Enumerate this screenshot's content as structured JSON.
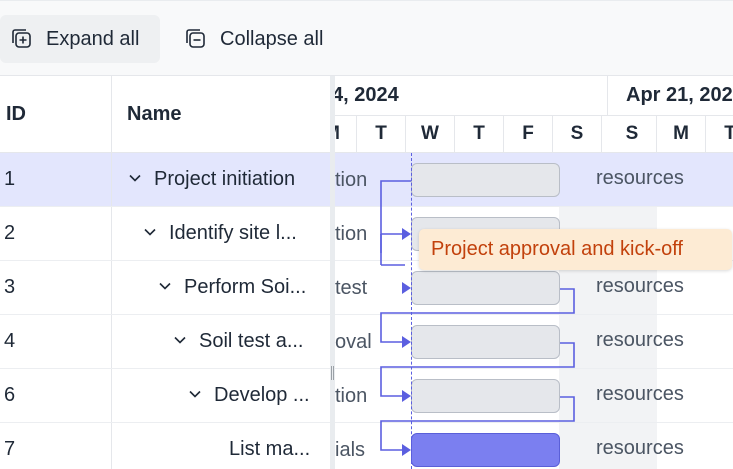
{
  "toolbar": {
    "expand_label": "Expand all",
    "collapse_label": "Collapse all",
    "expand_icon": "expand-all-icon",
    "collapse_icon": "collapse-all-icon"
  },
  "grid": {
    "columns": {
      "id": "ID",
      "name": "Name"
    },
    "rows": [
      {
        "id": "1",
        "name": "Project initiation"
      },
      {
        "id": "2",
        "name": "Identify site l..."
      },
      {
        "id": "3",
        "name": "Perform Soi..."
      },
      {
        "id": "4",
        "name": "Soil test a..."
      },
      {
        "id": "6",
        "name": "Develop ..."
      },
      {
        "id": "7",
        "name": "List ma..."
      }
    ]
  },
  "timeline": {
    "weeks": [
      "4, 2024",
      "Apr 21, 202"
    ],
    "days": [
      "M",
      "T",
      "W",
      "T",
      "F",
      "S",
      "S",
      "M",
      "T"
    ],
    "row_left_text": [
      "tion",
      "tion",
      "test",
      "oval",
      "tion",
      "ials"
    ],
    "bar_labels": [
      "resources",
      "",
      "resources",
      "resources",
      "resources",
      "resources"
    ]
  },
  "tooltip": {
    "text": "Project approval and kick-off"
  },
  "colors": {
    "accent": "#5b5fe0",
    "selected_row": "#e3e6fd",
    "tooltip_bg": "#fdebd4",
    "tooltip_text": "#c2410c",
    "active_bar": "#7b7ff0"
  }
}
